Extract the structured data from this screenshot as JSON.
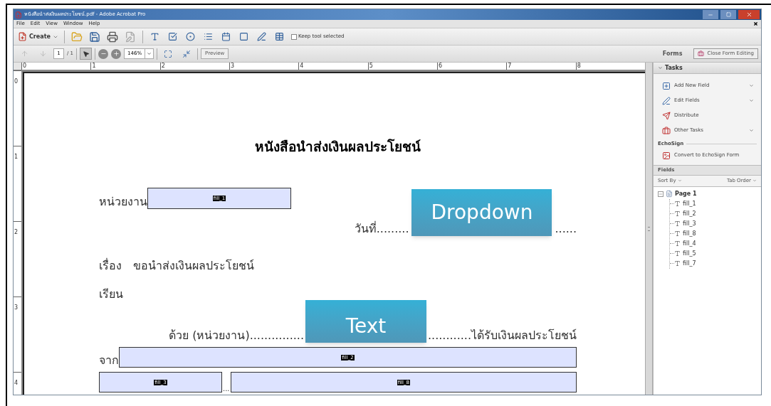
{
  "window": {
    "title": "หนังสือนำส่งเงินผลประโยชน์.pdf - Adobe Acrobat Pro"
  },
  "menu": [
    "File",
    "Edit",
    "View",
    "Window",
    "Help"
  ],
  "toolbar": {
    "create": "Create",
    "keep_tool": {
      "label": "Keep tool selected",
      "checked": false
    }
  },
  "nav": {
    "page": "1",
    "page_total": "/ 1",
    "zoom": "146%",
    "preview": "Preview"
  },
  "forms": {
    "label": "Forms",
    "close_button": "Close Form Editing"
  },
  "ruler": {
    "horizontal": [
      "0",
      "1",
      "2",
      "3",
      "4",
      "5",
      "6",
      "7",
      "8"
    ],
    "vertical": [
      "0",
      "1",
      "2",
      "3",
      "4"
    ]
  },
  "document": {
    "title": "หนังสือนำส่งเงินผลประโยชน์",
    "unit_label": "หน่วยงาน",
    "date_line_start": "วันที่.........",
    "date_line_end": "......",
    "subject_label": "เรื่อง",
    "subject": "ขอนำส่งเงินผลประโยชน์",
    "to_label": "เรียน",
    "body_line_start": "ด้วย (หน่วยงาน)...............",
    "body_line_end": "............ได้รับเงินผลประโยชน์",
    "from_label": "จาก",
    "separator": "...",
    "fields": [
      {
        "name": "fill_1"
      },
      {
        "name": "fill_2"
      },
      {
        "name": "fill_3"
      },
      {
        "name": "fill_8"
      }
    ]
  },
  "callouts": [
    {
      "text": "Dropdown"
    },
    {
      "text": "Text"
    }
  ],
  "tasks": {
    "title": "Tasks",
    "expanded": true,
    "items": [
      {
        "label": "Add New Field",
        "dropdown": true
      },
      {
        "label": "Edit Fields",
        "dropdown": true
      },
      {
        "label": "Distribute",
        "dropdown": false
      },
      {
        "label": "Other Tasks",
        "dropdown": true
      }
    ],
    "echosign": {
      "title": "EchoSign",
      "item": "Convert to EchoSign Form"
    }
  },
  "fields_panel": {
    "title": "Fields",
    "sort_by": "Sort By",
    "tab_order": "Tab Order",
    "tree": [
      {
        "label": "Page 1",
        "expanded": true,
        "children": [
          {
            "label": "fill_1"
          },
          {
            "label": "fill_2"
          },
          {
            "label": "fill_3"
          },
          {
            "label": "fill_8"
          },
          {
            "label": "fill_4"
          },
          {
            "label": "fill_5"
          },
          {
            "label": "fill_7"
          }
        ]
      }
    ]
  }
}
